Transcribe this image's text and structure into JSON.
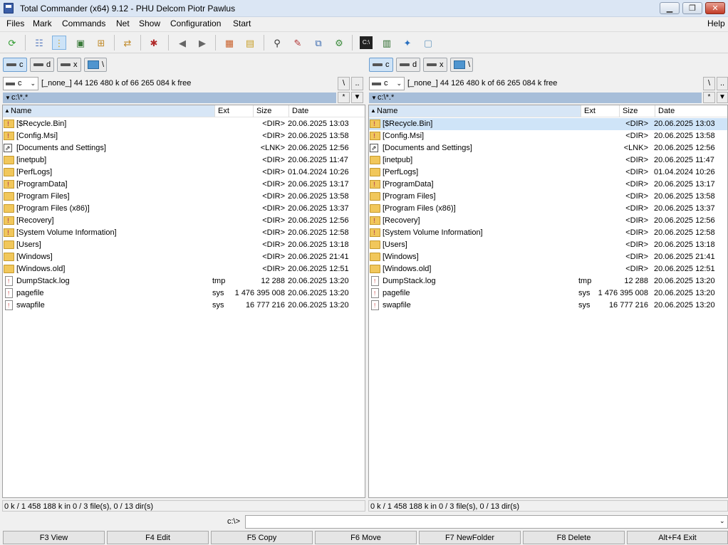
{
  "window": {
    "title": "Total Commander (x64) 9.12 - PHU Delcom Piotr Pawlus",
    "minimize_icon": "minimize-icon",
    "maximize_icon": "maximize-icon",
    "close_icon": "close-icon"
  },
  "menu": {
    "files": "Files",
    "mark": "Mark",
    "commands": "Commands",
    "net": "Net",
    "show": "Show",
    "configuration": "Configuration",
    "start": "Start",
    "help": "Help"
  },
  "toolbar_icons": [
    "refresh-icon",
    "brief-view-icon",
    "detailed-view-icon",
    "thumbnails-icon",
    "tree-view-icon",
    "invert-selection-icon",
    "magic-select-icon",
    "back-icon",
    "forward-icon",
    "pack-icon",
    "unpack-icon",
    "find-icon",
    "rename-tool-icon",
    "sync-dirs-icon",
    "ftp-icon",
    "cmd-prompt-icon",
    "network-icon",
    "settings-icon",
    "notepad-icon"
  ],
  "drive_buttons": {
    "c": "c",
    "d": "d",
    "x": "x",
    "net": "\\"
  },
  "left": {
    "drive_select": "c",
    "free_space": "[_none_]  44 126 480 k of 66 265 084 k free",
    "root_btn": "\\",
    "up_btn": "..",
    "path": "c:\\*.*",
    "status": "0 k / 1 458 188 k in 0 / 3 file(s), 0 / 13 dir(s)"
  },
  "right": {
    "drive_select": "c",
    "free_space": "[_none_]  44 126 480 k of 66 265 084 k free",
    "root_btn": "\\",
    "up_btn": "..",
    "path": "c:\\*.*",
    "status": "0 k / 1 458 188 k in 0 / 3 file(s), 0 / 13 dir(s)"
  },
  "path_buttons": {
    "star": "*",
    "history": "▼"
  },
  "columns": {
    "name": "Name",
    "ext": "Ext",
    "size": "Size",
    "date": "Date"
  },
  "files": [
    {
      "name": "[$Recycle.Bin]",
      "ext": "",
      "size": "<DIR>",
      "date": "20.06.2025 13:03",
      "icon": "sysfolder"
    },
    {
      "name": "[Config.Msi]",
      "ext": "",
      "size": "<DIR>",
      "date": "20.06.2025 13:58",
      "icon": "sysfolder"
    },
    {
      "name": "[Documents and Settings]",
      "ext": "",
      "size": "<LNK>",
      "date": "20.06.2025 12:56",
      "icon": "link"
    },
    {
      "name": "[inetpub]",
      "ext": "",
      "size": "<DIR>",
      "date": "20.06.2025 11:47",
      "icon": "folder"
    },
    {
      "name": "[PerfLogs]",
      "ext": "",
      "size": "<DIR>",
      "date": "01.04.2024 10:26",
      "icon": "folder"
    },
    {
      "name": "[ProgramData]",
      "ext": "",
      "size": "<DIR>",
      "date": "20.06.2025 13:17",
      "icon": "sysfolder"
    },
    {
      "name": "[Program Files]",
      "ext": "",
      "size": "<DIR>",
      "date": "20.06.2025 13:58",
      "icon": "folder"
    },
    {
      "name": "[Program Files (x86)]",
      "ext": "",
      "size": "<DIR>",
      "date": "20.06.2025 13:37",
      "icon": "folder"
    },
    {
      "name": "[Recovery]",
      "ext": "",
      "size": "<DIR>",
      "date": "20.06.2025 12:56",
      "icon": "sysfolder"
    },
    {
      "name": "[System Volume Information]",
      "ext": "",
      "size": "<DIR>",
      "date": "20.06.2025 12:58",
      "icon": "sysfolder"
    },
    {
      "name": "[Users]",
      "ext": "",
      "size": "<DIR>",
      "date": "20.06.2025 13:18",
      "icon": "folder"
    },
    {
      "name": "[Windows]",
      "ext": "",
      "size": "<DIR>",
      "date": "20.06.2025 21:41",
      "icon": "folder"
    },
    {
      "name": "[Windows.old]",
      "ext": "",
      "size": "<DIR>",
      "date": "20.06.2025 12:51",
      "icon": "folder"
    },
    {
      "name": "DumpStack.log",
      "ext": "tmp",
      "size": "12 288",
      "date": "20.06.2025 13:20",
      "icon": "file"
    },
    {
      "name": "pagefile",
      "ext": "sys",
      "size": "1 476 395 008",
      "date": "20.06.2025 13:20",
      "icon": "file"
    },
    {
      "name": "swapfile",
      "ext": "sys",
      "size": "16 777 216",
      "date": "20.06.2025 13:20",
      "icon": "file"
    }
  ],
  "right_selected_row": 0,
  "command_line": {
    "prompt": "c:\\>",
    "value": ""
  },
  "function_keys": [
    "F3 View",
    "F4 Edit",
    "F5 Copy",
    "F6 Move",
    "F7 NewFolder",
    "F8 Delete",
    "Alt+F4 Exit"
  ],
  "colors": {
    "title_bar": "#dbe6f4",
    "path_bar": "#a7bed9",
    "selected_row": "#cfe4f8",
    "close_button": "#c23b26"
  }
}
